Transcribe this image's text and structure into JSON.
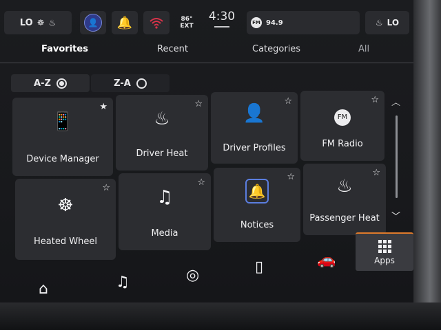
{
  "status": {
    "seat_left": "LO",
    "outside_temp": "86°",
    "outside_temp_label": "EXT",
    "time": "4:30",
    "radio_band": "FM",
    "radio_station": "94.9",
    "seat_right": "LO"
  },
  "tabs": [
    {
      "label": "Favorites",
      "active": true
    },
    {
      "label": "Recent",
      "active": false
    },
    {
      "label": "Categories",
      "active": false
    },
    {
      "label": "All",
      "active": false
    }
  ],
  "sort": {
    "az": "A-Z",
    "za": "Z-A",
    "selected": "A-Z"
  },
  "apps": [
    {
      "label": "Device Manager",
      "icon": "phone-settings-icon"
    },
    {
      "label": "Driver Heat",
      "icon": "heated-seat-icon"
    },
    {
      "label": "Driver Profiles",
      "icon": "person-icon"
    },
    {
      "label": "FM Radio",
      "icon": "fm-icon",
      "icon_text": "FM"
    },
    {
      "label": "Heated Wheel",
      "icon": "heated-wheel-icon"
    },
    {
      "label": "Media",
      "icon": "music-note-icon"
    },
    {
      "label": "Notices",
      "icon": "bell-icon"
    },
    {
      "label": "Passenger Heat",
      "icon": "heated-seat-icon"
    }
  ],
  "bottom_nav": {
    "home": "home-icon",
    "audio": "music-icon",
    "navigation": "navigation-icon",
    "phone": "phone-icon",
    "vehicle": "car-icon",
    "apps_label": "Apps"
  },
  "colors": {
    "accent": "#e07b2b",
    "highlight": "#5b7ee0"
  }
}
